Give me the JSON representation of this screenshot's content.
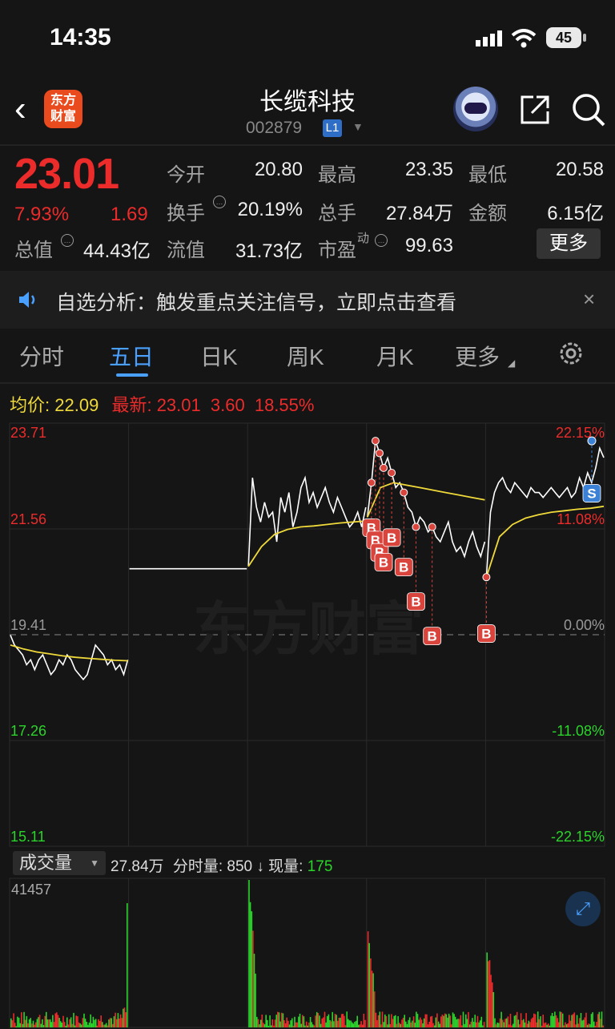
{
  "status": {
    "time": "14:35",
    "battery": "45"
  },
  "header": {
    "back": "‹",
    "logo_line1": "东方",
    "logo_line2": "财富",
    "title": "长缆科技",
    "code": "002879",
    "level": "L1"
  },
  "quote": {
    "price": "23.01",
    "change_pct": "7.93%",
    "change": "1.69",
    "open_label": "今开",
    "open": "20.80",
    "high_label": "最高",
    "high": "23.35",
    "low_label": "最低",
    "low": "20.58",
    "turnover_label": "换手",
    "turnover": "20.19%",
    "volume_label": "总手",
    "volume": "27.84万",
    "amount_label": "金额",
    "amount": "6.15亿",
    "mcap_label": "总值",
    "mcap": "44.43亿",
    "float_label": "流值",
    "float": "31.73亿",
    "pe_label": "市盈",
    "pe_sup": "动",
    "pe": "99.63",
    "more": "更多"
  },
  "notice": {
    "text": "自选分析：触发重点关注信号，立即点击查看",
    "close": "×"
  },
  "tabs": [
    {
      "label": "分时"
    },
    {
      "label": "五日"
    },
    {
      "label": "日K"
    },
    {
      "label": "周K"
    },
    {
      "label": "月K"
    },
    {
      "label": "更多"
    }
  ],
  "chart_info": {
    "avg_label": "均价:",
    "avg": "22.09",
    "latest_label": "最新:",
    "latest": "23.01",
    "change": "3.60",
    "change_pct": "18.55%"
  },
  "chart_data": {
    "type": "line",
    "axis_left": [
      "23.71",
      "21.56",
      "19.41",
      "17.26",
      "15.11"
    ],
    "axis_right": [
      "22.15%",
      "11.08%",
      "0.00%",
      "-11.08%",
      "-22.15%"
    ],
    "ylim": [
      15.11,
      23.71
    ],
    "reference_price": 19.41,
    "days": 5,
    "series": [
      {
        "values": [
          19.4,
          19.2,
          19.1,
          19.0,
          18.8,
          18.9,
          18.7,
          18.9,
          19.0,
          18.8,
          18.6,
          18.7,
          18.9,
          18.8,
          19.0,
          18.9,
          18.7,
          18.6,
          18.5,
          18.6,
          18.9,
          19.2,
          19.1,
          19.0,
          18.8,
          18.9,
          18.7,
          18.8,
          18.6,
          18.9
        ]
      },
      {
        "values": [
          20.75,
          20.75,
          20.75,
          20.75,
          20.75,
          20.75,
          20.75,
          20.75,
          20.75,
          20.75,
          20.75,
          20.75,
          20.75,
          20.75,
          20.75,
          20.75,
          20.75,
          20.75,
          20.75,
          20.75,
          20.75,
          20.75,
          20.75,
          20.75,
          20.75,
          20.75,
          20.75,
          20.75,
          20.75,
          20.75
        ]
      },
      {
        "values": [
          20.8,
          22.6,
          22.0,
          21.7,
          22.1,
          21.8,
          21.9,
          21.3,
          22.2,
          21.9,
          22.3,
          21.6,
          21.9,
          22.4,
          22.6,
          22.1,
          22.3,
          22.0,
          22.2,
          22.4,
          22.1,
          21.9,
          22.2,
          22.0,
          21.8,
          21.6,
          21.7,
          21.9,
          21.6,
          22.0
        ]
      },
      {
        "values": [
          21.8,
          22.5,
          23.35,
          23.1,
          22.8,
          23.0,
          22.7,
          22.4,
          22.5,
          22.3,
          22.0,
          21.9,
          21.6,
          21.8,
          21.7,
          21.5,
          21.6,
          21.4,
          21.3,
          21.5,
          21.7,
          21.3,
          21.1,
          21.2,
          21.0,
          21.3,
          21.5,
          21.2,
          21.0,
          21.3
        ]
      },
      {
        "values": [
          20.58,
          21.9,
          22.3,
          22.5,
          22.6,
          22.4,
          22.3,
          22.5,
          22.4,
          22.3,
          22.2,
          22.4,
          22.3,
          22.3,
          22.2,
          22.3,
          22.4,
          22.3,
          22.2,
          22.3,
          22.4,
          22.2,
          22.3,
          22.6,
          22.4,
          22.7,
          22.5,
          22.8,
          23.2,
          23.01
        ]
      }
    ],
    "avg_series": [
      {
        "values": [
          19.2,
          19.12,
          19.06,
          19.02,
          18.98,
          18.95,
          18.93,
          18.91,
          18.89,
          18.88
        ]
      },
      {
        "values": []
      },
      {
        "values": [
          20.8,
          21.2,
          21.45,
          21.55,
          21.6,
          21.62,
          21.65,
          21.68,
          21.7,
          21.72
        ]
      },
      {
        "values": [
          21.8,
          22.4,
          22.5,
          22.45,
          22.4,
          22.35,
          22.3,
          22.25,
          22.2,
          22.15
        ]
      },
      {
        "values": [
          20.58,
          21.4,
          21.65,
          21.78,
          21.85,
          21.9,
          21.93,
          21.96,
          21.98,
          22.02
        ]
      }
    ],
    "buy_marks": [
      "B",
      "B",
      "B",
      "B",
      "B",
      "B",
      "B",
      "B",
      "B"
    ],
    "sell_marks": [
      "S"
    ]
  },
  "volume": {
    "selector": "成交量",
    "total": "27.84万",
    "tick_label": "分时量:",
    "tick": "850",
    "now_label": "现量:",
    "now": "175",
    "max": "41457"
  },
  "watermark": "东方财富",
  "colors": {
    "up": "#ec2b2b",
    "down": "#2bd42b",
    "accent": "#4aa0ff",
    "avg": "#f0d93a"
  }
}
